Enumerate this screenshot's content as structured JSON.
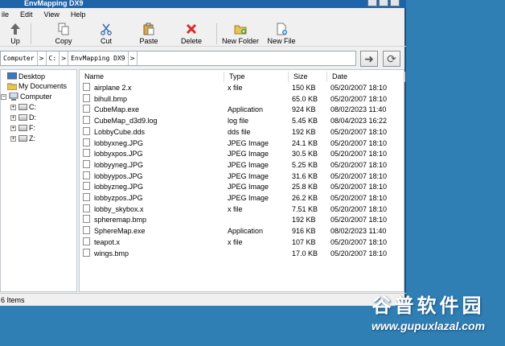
{
  "window": {
    "title": "EnvMapping DX9"
  },
  "menu": [
    "ile",
    "Edit",
    "View",
    "Help"
  ],
  "toolbar": {
    "up": "Up",
    "copy": "Copy",
    "cut": "Cut",
    "paste": "Paste",
    "delete": "Delete",
    "new_folder": "New Folder",
    "new_file": "New File"
  },
  "address": {
    "crumbs": [
      "Computer",
      "C:",
      "EnvMapping DX9"
    ]
  },
  "tree": {
    "desktop": "Desktop",
    "my_documents": "My Documents",
    "computer": "Computer",
    "drives": [
      "C:",
      "D:",
      "F:",
      "Z:"
    ]
  },
  "columns": {
    "name": "Name",
    "type": "Type",
    "size": "Size",
    "date": "Date"
  },
  "files": [
    {
      "name": "airplane 2.x",
      "type": "x file",
      "size": "150 KB",
      "date": "05/20/2007 18:10"
    },
    {
      "name": "bihull.bmp",
      "type": "",
      "size": "65.0 KB",
      "date": "05/20/2007 18:10"
    },
    {
      "name": "CubeMap.exe",
      "type": "Application",
      "size": "924 KB",
      "date": "08/02/2023 11:40"
    },
    {
      "name": "CubeMap_d3d9.log",
      "type": "log file",
      "size": "5.45 KB",
      "date": "08/04/2023 16:22"
    },
    {
      "name": "LobbyCube.dds",
      "type": "dds file",
      "size": "192 KB",
      "date": "05/20/2007 18:10"
    },
    {
      "name": "lobbyxneg.JPG",
      "type": "JPEG Image",
      "size": "24.1 KB",
      "date": "05/20/2007 18:10"
    },
    {
      "name": "lobbyxpos.JPG",
      "type": "JPEG Image",
      "size": "30.5 KB",
      "date": "05/20/2007 18:10"
    },
    {
      "name": "lobbyyneg.JPG",
      "type": "JPEG Image",
      "size": "5.25 KB",
      "date": "05/20/2007 18:10"
    },
    {
      "name": "lobbyypos.JPG",
      "type": "JPEG Image",
      "size": "31.6 KB",
      "date": "05/20/2007 18:10"
    },
    {
      "name": "lobbyzneg.JPG",
      "type": "JPEG Image",
      "size": "25.8 KB",
      "date": "05/20/2007 18:10"
    },
    {
      "name": "lobbyzpos.JPG",
      "type": "JPEG Image",
      "size": "26.2 KB",
      "date": "05/20/2007 18:10"
    },
    {
      "name": "lobby_skybox.x",
      "type": "x file",
      "size": "7.51 KB",
      "date": "05/20/2007 18:10"
    },
    {
      "name": "spheremap.bmp",
      "type": "",
      "size": "192 KB",
      "date": "05/20/2007 18:10"
    },
    {
      "name": "SphereMap.exe",
      "type": "Application",
      "size": "916 KB",
      "date": "08/02/2023 11:40"
    },
    {
      "name": "teapot.x",
      "type": "x file",
      "size": "107 KB",
      "date": "05/20/2007 18:10"
    },
    {
      "name": "wings.bmp",
      "type": "",
      "size": "17.0 KB",
      "date": "05/20/2007 18:10"
    }
  ],
  "status": {
    "text": "6 Items"
  },
  "watermark": {
    "title": "谷普软件园",
    "url": "www.gupuxlazal.com"
  }
}
